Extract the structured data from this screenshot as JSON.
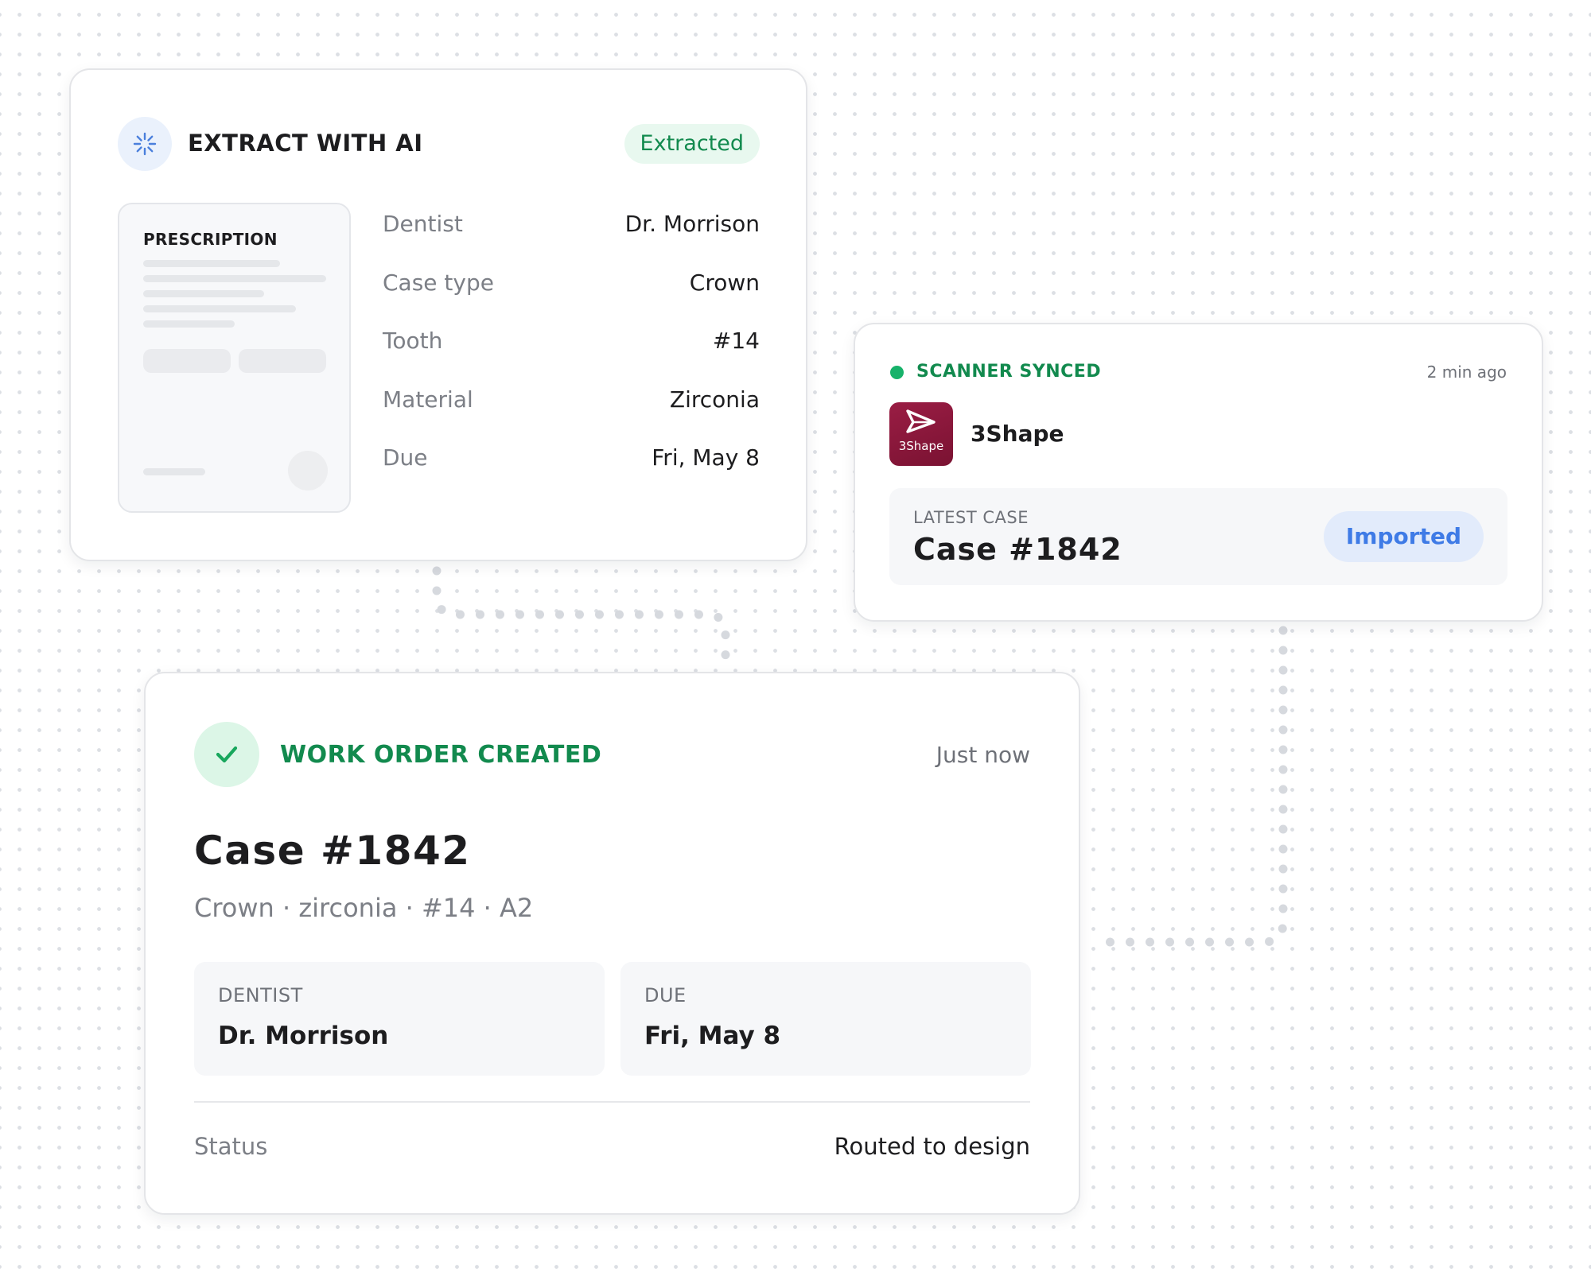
{
  "extract": {
    "title": "EXTRACT WITH AI",
    "status_badge": "Extracted",
    "icon": "sparkle-loader-icon",
    "document": {
      "title": "PRESCRIPTION"
    },
    "fields": [
      {
        "label": "Dentist",
        "value": "Dr. Morrison"
      },
      {
        "label": "Case type",
        "value": "Crown"
      },
      {
        "label": "Tooth",
        "value": "#14"
      },
      {
        "label": "Material",
        "value": "Zirconia"
      },
      {
        "label": "Due",
        "value": "Fri, May 8"
      }
    ]
  },
  "scanner": {
    "status": "SCANNER SYNCED",
    "time": "2 min ago",
    "app_name": "3Shape",
    "app_icon_text": "3Shape",
    "latest_label": "LATEST CASE",
    "latest_case": "Case #1842",
    "badge": "Imported"
  },
  "work_order": {
    "title": "WORK ORDER CREATED",
    "time": "Just now",
    "case": "Case #1842",
    "summary": "Crown · zirconia · #14 · A2",
    "dentist_label": "DENTIST",
    "dentist_value": "Dr. Morrison",
    "due_label": "DUE",
    "due_value": "Fri, May 8",
    "status_label": "Status",
    "status_value": "Routed to design"
  },
  "colors": {
    "success_green": "#128a4e",
    "sync_dot": "#17b26a",
    "accent_blue": "#3f7be6",
    "brand_3shape": "#8c1a3c",
    "border": "#e4e5e8"
  }
}
